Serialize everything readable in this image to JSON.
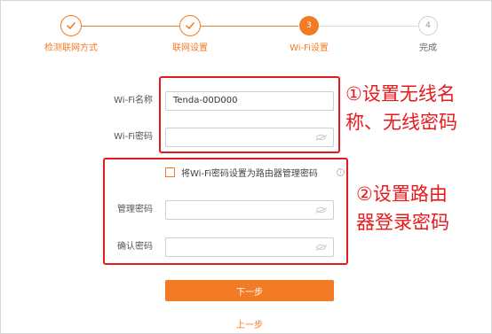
{
  "stepper": {
    "steps": [
      {
        "label": "检测联网方式",
        "state": "done",
        "number": ""
      },
      {
        "label": "联网设置",
        "state": "done",
        "number": ""
      },
      {
        "label": "Wi-Fi设置",
        "state": "active",
        "number": "3"
      },
      {
        "label": "完成",
        "state": "pending",
        "number": "4"
      }
    ]
  },
  "wifi": {
    "name_label": "Wi-Fi名称",
    "name_value": "Tenda-00D000",
    "password_label": "Wi-Fi密码",
    "password_value": ""
  },
  "admin": {
    "checkbox_label": "将Wi-Fi密码设置为路由器管理密码",
    "checkbox_checked": false,
    "password_label": "管理密码",
    "password_value": "",
    "confirm_label": "确认密码",
    "confirm_value": ""
  },
  "annotations": {
    "note1_line1": "①设置无线名",
    "note1_line2": "称、无线密码",
    "note2_line1": "②设置路由",
    "note2_line2": "器登录密码"
  },
  "actions": {
    "next_label": "下一步",
    "prev_label": "上一步"
  },
  "colors": {
    "accent": "#f47b25",
    "annotation": "#e8191d"
  },
  "icons": {
    "done_step": "check-icon",
    "password_toggle": "eye-hidden-icon",
    "info": "info-icon"
  }
}
